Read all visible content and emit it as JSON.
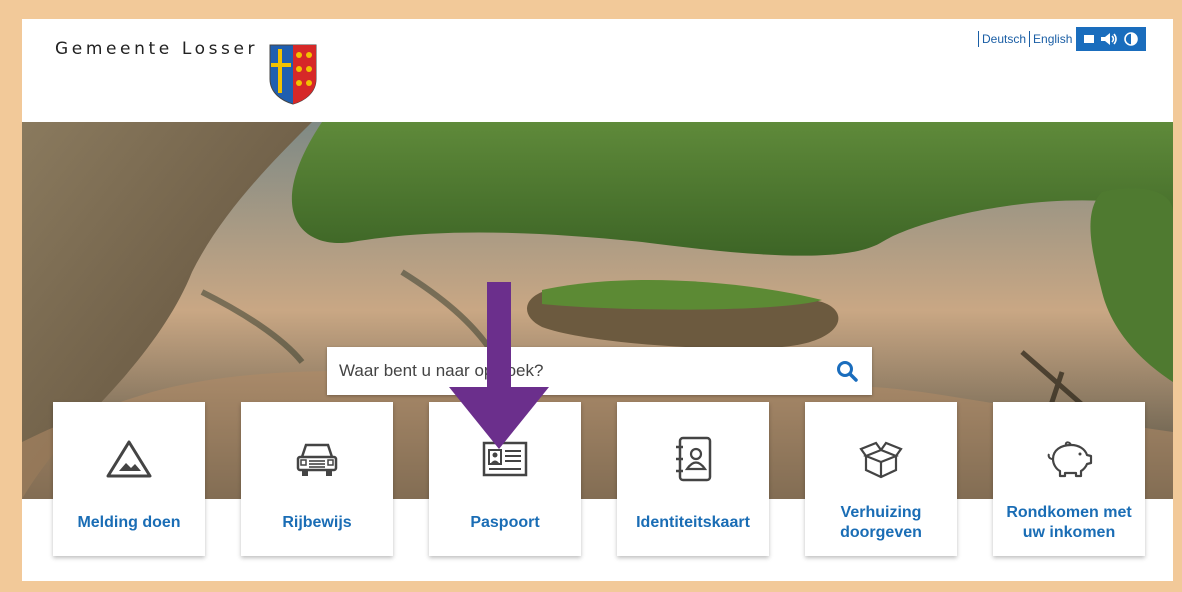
{
  "site": {
    "name": "Gemeente Losser"
  },
  "header": {
    "languages": [
      "Deutsch",
      "English"
    ]
  },
  "search": {
    "placeholder": "Waar bent u naar op zoek?"
  },
  "tiles": [
    {
      "label": "Melding doen",
      "icon": "warning-triangle-icon"
    },
    {
      "label": "Rijbewijs",
      "icon": "car-icon"
    },
    {
      "label": "Paspoort",
      "icon": "id-card-icon"
    },
    {
      "label": "Identiteitskaart",
      "icon": "address-book-icon"
    },
    {
      "label": "Verhuizing doorgeven",
      "icon": "moving-box-icon"
    },
    {
      "label": "Rondkomen met uw inkomen",
      "icon": "piggy-bank-icon"
    }
  ],
  "colors": {
    "accent": "#1a6dbd",
    "tile_text": "#1a6db5",
    "frame": "#f2c999",
    "arrow": "#6b2f8c"
  }
}
